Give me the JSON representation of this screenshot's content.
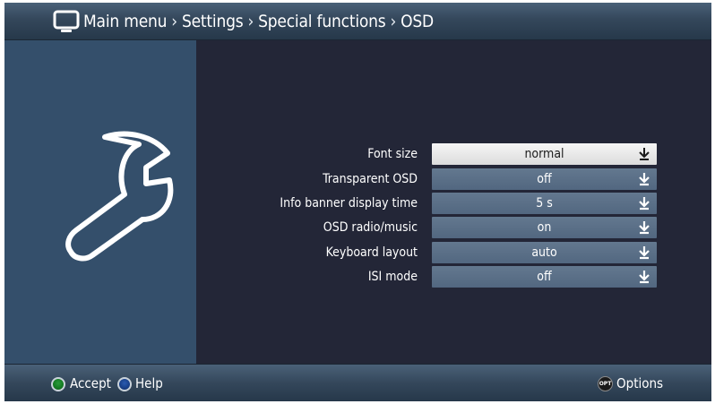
{
  "header": {
    "breadcrumb": [
      "Main menu",
      "Settings",
      "Special functions",
      "OSD"
    ],
    "separator": "›"
  },
  "settings": [
    {
      "label": "Font size",
      "value": "normal",
      "selected": true
    },
    {
      "label": "Transparent OSD",
      "value": "off",
      "selected": false
    },
    {
      "label": "Info banner display time",
      "value": "5 s",
      "selected": false
    },
    {
      "label": "OSD radio/music",
      "value": "on",
      "selected": false
    },
    {
      "label": "Keyboard layout",
      "value": "auto",
      "selected": false
    },
    {
      "label": "ISI mode",
      "value": "off",
      "selected": false
    }
  ],
  "footer": {
    "accept_label": "Accept",
    "help_label": "Help",
    "options_label": "Options",
    "opt_badge": "OPT"
  },
  "icons": {
    "header": "tv-icon",
    "panel": "wrench-icon",
    "dropdown": "down-arrow-icon",
    "accept_button_color": "#137a22",
    "help_button_color": "#183f88"
  }
}
